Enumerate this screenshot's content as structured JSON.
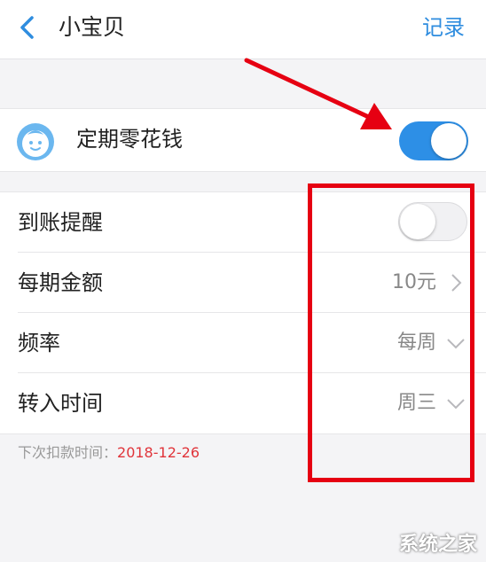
{
  "header": {
    "title": "小宝贝",
    "action_label": "记录"
  },
  "main_setting": {
    "label": "定期零花钱",
    "enabled": true
  },
  "settings": [
    {
      "label": "到账提醒",
      "type": "toggle",
      "enabled": false
    },
    {
      "label": "每期金额",
      "type": "link",
      "value": "10元",
      "icon": "chevron-right-icon"
    },
    {
      "label": "频率",
      "type": "select",
      "value": "每周",
      "icon": "chevron-down-icon"
    },
    {
      "label": "转入时间",
      "type": "select",
      "value": "周三",
      "icon": "chevron-down-icon"
    }
  ],
  "note": {
    "prefix": "下次扣款时间：",
    "date": "2018-12-26"
  },
  "colors": {
    "accent": "#2d8fe6",
    "annotation": "#e60012",
    "date_text": "#e0343a"
  },
  "watermark": "系统之家"
}
